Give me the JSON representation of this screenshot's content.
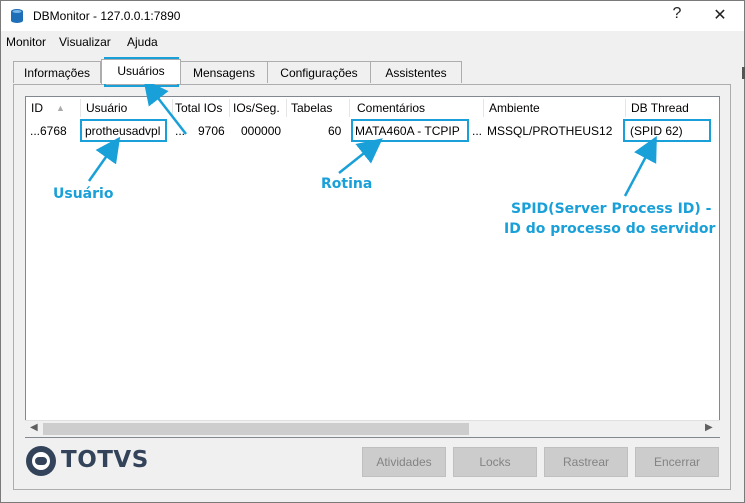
{
  "window": {
    "title": "DBMonitor - 127.0.0.1:7890",
    "help_glyph": "?",
    "close_glyph": "✕"
  },
  "menu": [
    "Monitor",
    "Visualizar",
    "Ajuda"
  ],
  "tabs": [
    "Informações",
    "Usuários",
    "Mensagens",
    "Configurações",
    "Assistentes"
  ],
  "active_tab": "Usuários",
  "table": {
    "columns": [
      "ID",
      "Usuário",
      "Total IOs",
      "IOs/Seg.",
      "Tabelas",
      "Comentários",
      "Ambiente",
      "DB Thread"
    ],
    "sort_glyph": "▲",
    "rows": [
      [
        "...6768",
        "protheusadvpl",
        "...",
        "9706",
        "000000",
        "60",
        "MATA460A - TCPIP",
        "...",
        "MSSQL/PROTHEUS12",
        "(SPID 62)"
      ]
    ]
  },
  "annotations": {
    "usuario": "Usuário",
    "rotina": "Rotina",
    "spid_line1": "SPID(Server Process ID) -",
    "spid_line2": "ID do processo do servidor"
  },
  "logo_text": "TOTVS",
  "buttons": [
    "Atividades",
    "Locks",
    "Rastrear",
    "Encerrar"
  ],
  "colors": {
    "annotation": "#1aa0d8",
    "button_disabled_bg": "#cccccc",
    "button_disabled_text": "#838383",
    "logo": "#33445a"
  },
  "icons": [
    "database-icon",
    "totvs-logo-icon",
    "sort-up-icon",
    "arrow-left-icon",
    "arrow-right-icon"
  ]
}
